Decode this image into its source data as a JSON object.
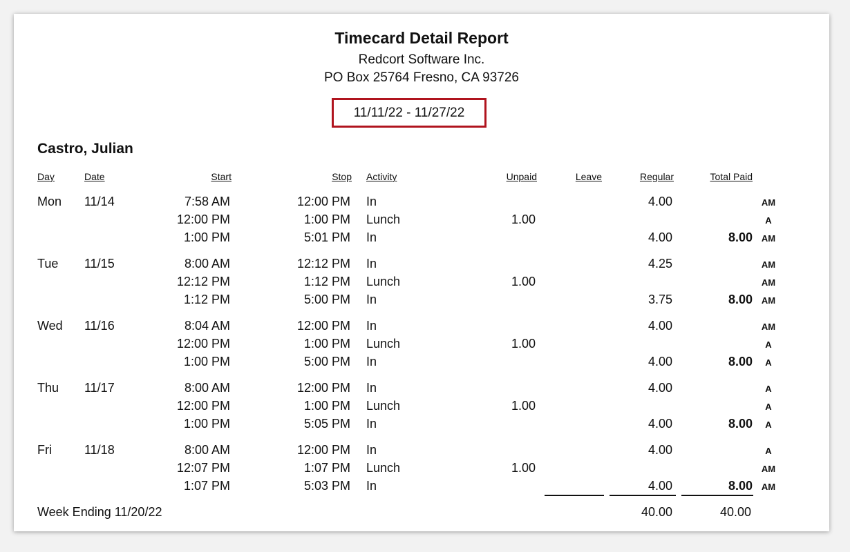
{
  "report": {
    "title": "Timecard Detail Report",
    "company": "Redcort Software Inc.",
    "address": "PO Box 25764  Fresno, CA 93726",
    "date_range": "11/11/22 - 11/27/22"
  },
  "employee": "Castro, Julian",
  "columns": {
    "day": "Day",
    "date": "Date",
    "start": "Start",
    "stop": "Stop",
    "activity": "Activity",
    "unpaid": "Unpaid",
    "leave": "Leave",
    "regular": "Regular",
    "total_paid": "Total Paid"
  },
  "rows": [
    {
      "day": "Mon",
      "date": "11/14",
      "start": "7:58 AM",
      "stop": "12:00 PM",
      "activity": "In",
      "unpaid": "",
      "regular": "4.00",
      "total": "",
      "flag": "AM"
    },
    {
      "day": "",
      "date": "",
      "start": "12:00 PM",
      "stop": "1:00 PM",
      "activity": "Lunch",
      "unpaid": "1.00",
      "regular": "",
      "total": "",
      "flag": "A"
    },
    {
      "day": "",
      "date": "",
      "start": "1:00 PM",
      "stop": "5:01 PM",
      "activity": "In",
      "unpaid": "",
      "regular": "4.00",
      "total": "8.00",
      "flag": "AM"
    },
    {
      "day": "Tue",
      "date": "11/15",
      "start": "8:00 AM",
      "stop": "12:12 PM",
      "activity": "In",
      "unpaid": "",
      "regular": "4.25",
      "total": "",
      "flag": "AM"
    },
    {
      "day": "",
      "date": "",
      "start": "12:12 PM",
      "stop": "1:12 PM",
      "activity": "Lunch",
      "unpaid": "1.00",
      "regular": "",
      "total": "",
      "flag": "AM"
    },
    {
      "day": "",
      "date": "",
      "start": "1:12 PM",
      "stop": "5:00 PM",
      "activity": "In",
      "unpaid": "",
      "regular": "3.75",
      "total": "8.00",
      "flag": "AM"
    },
    {
      "day": "Wed",
      "date": "11/16",
      "start": "8:04 AM",
      "stop": "12:00 PM",
      "activity": "In",
      "unpaid": "",
      "regular": "4.00",
      "total": "",
      "flag": "AM"
    },
    {
      "day": "",
      "date": "",
      "start": "12:00 PM",
      "stop": "1:00 PM",
      "activity": "Lunch",
      "unpaid": "1.00",
      "regular": "",
      "total": "",
      "flag": "A"
    },
    {
      "day": "",
      "date": "",
      "start": "1:00 PM",
      "stop": "5:00 PM",
      "activity": "In",
      "unpaid": "",
      "regular": "4.00",
      "total": "8.00",
      "flag": "A"
    },
    {
      "day": "Thu",
      "date": "11/17",
      "start": "8:00 AM",
      "stop": "12:00 PM",
      "activity": "In",
      "unpaid": "",
      "regular": "4.00",
      "total": "",
      "flag": "A"
    },
    {
      "day": "",
      "date": "",
      "start": "12:00 PM",
      "stop": "1:00 PM",
      "activity": "Lunch",
      "unpaid": "1.00",
      "regular": "",
      "total": "",
      "flag": "A"
    },
    {
      "day": "",
      "date": "",
      "start": "1:00 PM",
      "stop": "5:05 PM",
      "activity": "In",
      "unpaid": "",
      "regular": "4.00",
      "total": "8.00",
      "flag": "A"
    },
    {
      "day": "Fri",
      "date": "11/18",
      "start": "8:00 AM",
      "stop": "12:00 PM",
      "activity": "In",
      "unpaid": "",
      "regular": "4.00",
      "total": "",
      "flag": "A"
    },
    {
      "day": "",
      "date": "",
      "start": "12:07 PM",
      "stop": "1:07 PM",
      "activity": "Lunch",
      "unpaid": "1.00",
      "regular": "",
      "total": "",
      "flag": "AM"
    },
    {
      "day": "",
      "date": "",
      "start": "1:07 PM",
      "stop": "5:03 PM",
      "activity": "In",
      "unpaid": "",
      "regular": "4.00",
      "total": "8.00",
      "flag": "AM"
    }
  ],
  "week_total": {
    "label": "Week Ending 11/20/22",
    "regular": "40.00",
    "total_paid": "40.00"
  }
}
